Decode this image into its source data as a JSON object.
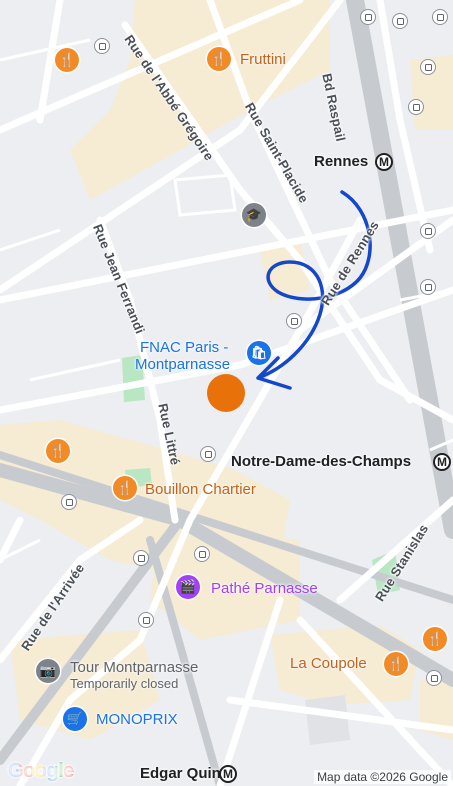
{
  "map": {
    "streets": {
      "bd_raspail": "Bd Raspail",
      "rue_abbe_gregoire": "Rue de l'Abbé Grégoire",
      "rue_saint_placide": "Rue Saint-Placide",
      "rue_de_rennes": "Rue de Rennes",
      "rue_jean_ferrandi": "Rue Jean Ferrandi",
      "rue_littre": "Rue Littré",
      "rue_stanislas": "Rue Stanislas",
      "rue_arrivee": "Rue de l'Arrivée"
    },
    "stations": {
      "rennes": "Rennes",
      "notre_dame_des_champs": "Notre-Dame-des-Champs",
      "edgar_quinet": "Edgar Quinet"
    },
    "metro_symbol": "M",
    "pois": {
      "fruttini": {
        "name": "Fruttini",
        "icon": "restaurant-icon"
      },
      "fnac": {
        "name_line1": "FNAC Paris -",
        "name_line2": "Montparnasse",
        "icon": "shopping-bag-icon"
      },
      "bouillon_chartier": {
        "name": "Bouillon Chartier",
        "icon": "restaurant-icon"
      },
      "pathe_parnasse": {
        "name": "Pathé Parnasse",
        "icon": "movie-icon"
      },
      "la_coupole": {
        "name": "La Coupole",
        "icon": "restaurant-icon"
      },
      "tour_montparnasse": {
        "name": "Tour Montparnasse",
        "status": "Temporarily closed",
        "icon": "camera-icon"
      },
      "monoprix": {
        "name": "MONOPRIX",
        "icon": "cart-icon"
      },
      "school": {
        "icon": "school-icon"
      }
    },
    "location_marker": {
      "color": "#e8710a"
    },
    "annotation": {
      "color": "#1447c9",
      "type": "hand-drawn arrow"
    },
    "colors": {
      "background": "#eceef1",
      "road": "#ffffff",
      "main_road": "#c2c6cc",
      "commercial": "#f6ebd3",
      "park": "#b9e6c3",
      "restaurant": "#f28b26",
      "shop": "#1a73e8",
      "cinema": "#a142f4"
    }
  },
  "branding": {
    "logo": "Google"
  },
  "attribution": "Map data ©2026 Google"
}
